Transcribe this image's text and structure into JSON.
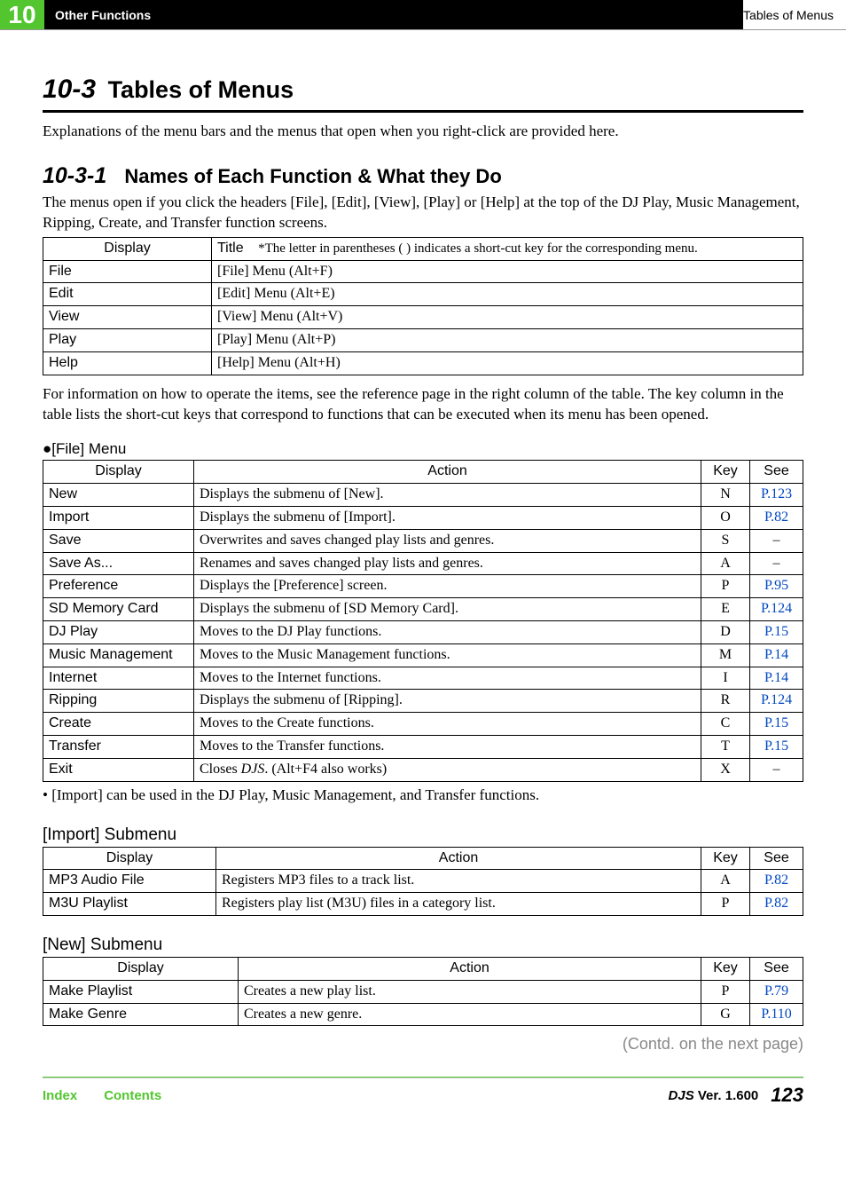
{
  "header": {
    "chapter_number": "10",
    "chapter_title": "Other Functions",
    "breadcrumb": "Tables of Menus"
  },
  "section": {
    "number": "10-3",
    "title": "Tables of Menus",
    "intro": "Explanations of the menu bars and the menus that open when you right-click are provided here."
  },
  "subsection": {
    "number": "10-3-1",
    "title": "Names of Each Function & What they Do",
    "lead": "The menus open if you click the headers [File], [Edit], [View], [Play] or [Help] at the top of the DJ Play, Music Management, Ripping, Create, and Transfer function screens."
  },
  "menus_table": {
    "headers": {
      "display": "Display",
      "title_label": "Title",
      "title_note": "*The letter in parentheses ( ) indicates a short-cut key for the corresponding menu."
    },
    "rows": [
      {
        "display": "File",
        "title": "[File] Menu (Alt+F)"
      },
      {
        "display": "Edit",
        "title": "[Edit] Menu (Alt+E)"
      },
      {
        "display": "View",
        "title": "[View] Menu (Alt+V)"
      },
      {
        "display": "Play",
        "title": "[Play] Menu (Alt+P)"
      },
      {
        "display": "Help",
        "title": "[Help] Menu (Alt+H)"
      }
    ]
  },
  "info_para": "For information on how to operate the items, see the reference page in the right column of the table. The key column in the table lists the short-cut keys that correspond to functions that can be executed when its menu has been opened.",
  "file_menu": {
    "heading": "●[File] Menu",
    "headers": {
      "display": "Display",
      "action": "Action",
      "key": "Key",
      "see": "See"
    },
    "rows": [
      {
        "display": "New",
        "action": "Displays the submenu of [New].",
        "key": "N",
        "see": "P.123",
        "link": true
      },
      {
        "display": "Import",
        "action": "Displays the submenu of [Import].",
        "key": "O",
        "see": "P.82",
        "link": true
      },
      {
        "display": "Save",
        "action": "Overwrites and saves changed play lists and genres.",
        "key": "S",
        "see": "–",
        "link": false
      },
      {
        "display": "Save As...",
        "action": "Renames and saves changed play lists and genres.",
        "key": "A",
        "see": "–",
        "link": false
      },
      {
        "display": "Preference",
        "action": "Displays the [Preference] screen.",
        "key": "P",
        "see": "P.95",
        "link": true
      },
      {
        "display": "SD Memory Card",
        "action": "Displays the submenu of [SD Memory Card].",
        "key": "E",
        "see": "P.124",
        "link": true
      },
      {
        "display": "DJ Play",
        "action": "Moves to the DJ Play functions.",
        "key": "D",
        "see": "P.15",
        "link": true
      },
      {
        "display": "Music Management",
        "action": "Moves to the Music Management functions.",
        "key": "M",
        "see": "P.14",
        "link": true
      },
      {
        "display": "Internet",
        "action": "Moves to the Internet functions.",
        "key": "I",
        "see": "P.14",
        "link": true
      },
      {
        "display": "Ripping",
        "action": "Displays the submenu of [Ripping].",
        "key": "R",
        "see": "P.124",
        "link": true
      },
      {
        "display": "Create",
        "action": "Moves to the Create functions.",
        "key": "C",
        "see": "P.15",
        "link": true
      },
      {
        "display": "Transfer",
        "action": "Moves to the Transfer functions.",
        "key": "T",
        "see": "P.15",
        "link": true
      },
      {
        "display": "Exit",
        "action_prefix": "Closes ",
        "action_ital": "DJS",
        "action_suffix": ". (Alt+F4 also works)",
        "key": "X",
        "see": "–",
        "link": false
      }
    ],
    "note": "• [Import] can be used in the DJ Play, Music Management, and Transfer functions."
  },
  "import_submenu": {
    "heading": "[Import] Submenu",
    "headers": {
      "display": "Display",
      "action": "Action",
      "key": "Key",
      "see": "See"
    },
    "rows": [
      {
        "display": "MP3 Audio File",
        "action": "Registers MP3 files to a track list.",
        "key": "A",
        "see": "P.82"
      },
      {
        "display": "M3U Playlist",
        "action": "Registers play list (M3U) files in a category list.",
        "key": "P",
        "see": "P.82"
      }
    ]
  },
  "new_submenu": {
    "heading": "[New] Submenu",
    "headers": {
      "display": "Display",
      "action": "Action",
      "key": "Key",
      "see": "See"
    },
    "rows": [
      {
        "display": "Make Playlist",
        "action": "Creates a new play list.",
        "key": "P",
        "see": "P.79"
      },
      {
        "display": "Make Genre",
        "action": "Creates a new genre.",
        "key": "G",
        "see": "P.110"
      }
    ]
  },
  "contd": "(Contd. on the next page)",
  "footer": {
    "index": "Index",
    "contents": "Contents",
    "product": "DJS",
    "version": " Ver. 1.600",
    "page": "123"
  }
}
